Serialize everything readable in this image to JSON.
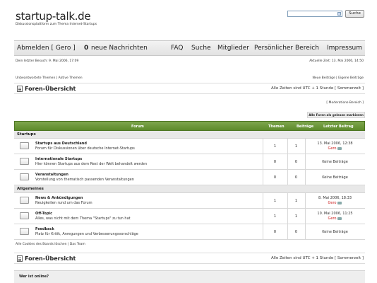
{
  "header": {
    "logo": "startup-talk.de",
    "tagline": "Diskussionsplattform zum Thema Internet-Startups",
    "search_button": "Suche",
    "search_placeholder": ""
  },
  "nav": {
    "logout": "Abmelden [ Gero ]",
    "messages_count": "0",
    "messages_label": "neue Nachrichten",
    "faq": "FAQ",
    "search": "Suche",
    "members": "Mitglieder",
    "personal": "Persönlicher Bereich",
    "imprint": "Impressum"
  },
  "meta": {
    "last_visit": "Dein letzter Besuch: 9. Mai 2006, 17:09",
    "current_time": "Aktuelle Zeit: 13. Mai 2006, 14:50"
  },
  "links": {
    "left": "Unbeantwortete Themen | Aktive Themen",
    "right": "Neue Beiträge | Eigene Beiträge"
  },
  "section": {
    "title": "Foren-Übersicht",
    "timezone": "Alle Zeiten sind UTC + 1 Stunde [ Sommerzeit ]",
    "moderation": "[ Moderations-Bereich ]",
    "mark_read": "Alle Foren als gelesen markieren"
  },
  "table": {
    "headers": {
      "forum": "Forum",
      "topics": "Themen",
      "posts": "Beiträge",
      "last": "Letzter Beitrag"
    },
    "categories": [
      {
        "name": "Startups",
        "forums": [
          {
            "name": "Startups aus Deutschland",
            "desc": "Forum für Diskussionen über deutsche Internet-Startups",
            "topics": "1",
            "posts": "1",
            "last_date": "13. Mai 2006, 12:38",
            "last_user": "Gero",
            "has_last": true
          },
          {
            "name": "Internationale Startups",
            "desc": "Hier können Startups aus dem Rest der Welt behandelt werden",
            "topics": "0",
            "posts": "0",
            "no_posts": "Keine Beiträge",
            "has_last": false
          },
          {
            "name": "Veranstaltungen",
            "desc": "Vorstellung von thematisch passenden Veranstaltungen",
            "topics": "0",
            "posts": "0",
            "no_posts": "Keine Beiträge",
            "has_last": false
          }
        ]
      },
      {
        "name": "Allgemeines",
        "forums": [
          {
            "name": "News & Ankündigungen",
            "desc": "Neuigkeiten rund um das Forum",
            "topics": "1",
            "posts": "1",
            "last_date": "8. Mai 2006, 18:33",
            "last_user": "Gero",
            "has_last": true
          },
          {
            "name": "Off-Topic",
            "desc": "Alles, was nicht mit dem Thema \"Startups\" zu tun hat",
            "topics": "1",
            "posts": "1",
            "last_date": "10. Mai 2006, 11:25",
            "last_user": "Gero",
            "has_last": true
          },
          {
            "name": "Feedback",
            "desc": "Platz für Kritik, Anregungen und Verbesserungsvorschläge",
            "topics": "0",
            "posts": "0",
            "no_posts": "Keine Beiträge",
            "has_last": false
          }
        ]
      }
    ]
  },
  "footer": {
    "cookies": "Alle Cookies des Boards löschen | Das Team",
    "who_online": "Wer ist online?"
  },
  "colors": {
    "header_green": "#6b9a3a",
    "user_red": "#cc2222"
  }
}
